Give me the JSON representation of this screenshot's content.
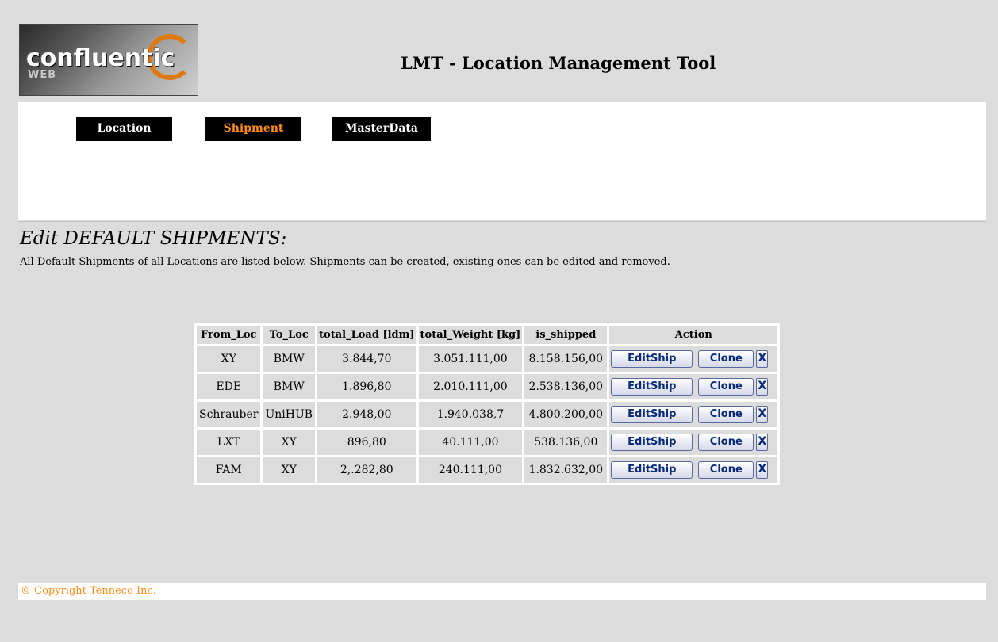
{
  "logo": {
    "word": "confluentic",
    "sub": "WEB"
  },
  "app_title": "LMT - Location Management Tool",
  "nav": {
    "location": "Location",
    "shipment": "Shipment",
    "masterdata": "MasterData"
  },
  "section": {
    "title": "Edit DEFAULT SHIPMENTS:",
    "description": "All Default Shipments of all Locations are listed below. Shipments can be created, existing ones can be edited and removed."
  },
  "table": {
    "headers": [
      "From_Loc",
      "To_Loc",
      "total_Load [ldm]",
      "total_Weight [kg]",
      "is_shipped",
      "Action"
    ],
    "rows": [
      {
        "from": "XY",
        "to": "BMW",
        "load": "3.844,70",
        "weight": "3.051.111,00",
        "shipped": "8.158.156,00"
      },
      {
        "from": "EDE",
        "to": "BMW",
        "load": "1.896,80",
        "weight": "2.010.111,00",
        "shipped": "2.538.136,00"
      },
      {
        "from": "Schrauber",
        "to": "UniHUB",
        "load": "2.948,00",
        "weight": "1.940.038,7",
        "shipped": "4.800.200,00"
      },
      {
        "from": "LXT",
        "to": "XY",
        "load": "896,80",
        "weight": "40.111,00",
        "shipped": "538.136,00"
      },
      {
        "from": "FAM",
        "to": "XY",
        "load": "2,.282,80",
        "weight": "240.111,00",
        "shipped": "1.832.632,00"
      }
    ],
    "buttons": {
      "edit": "EditShip",
      "clone": "Clone",
      "delete": "X"
    }
  },
  "footer": "© Copyright Tenneco Inc.",
  "colors": {
    "accent": "#ff8c1a",
    "background": "#dcdcdc",
    "button_text": "#0a2a7a"
  }
}
